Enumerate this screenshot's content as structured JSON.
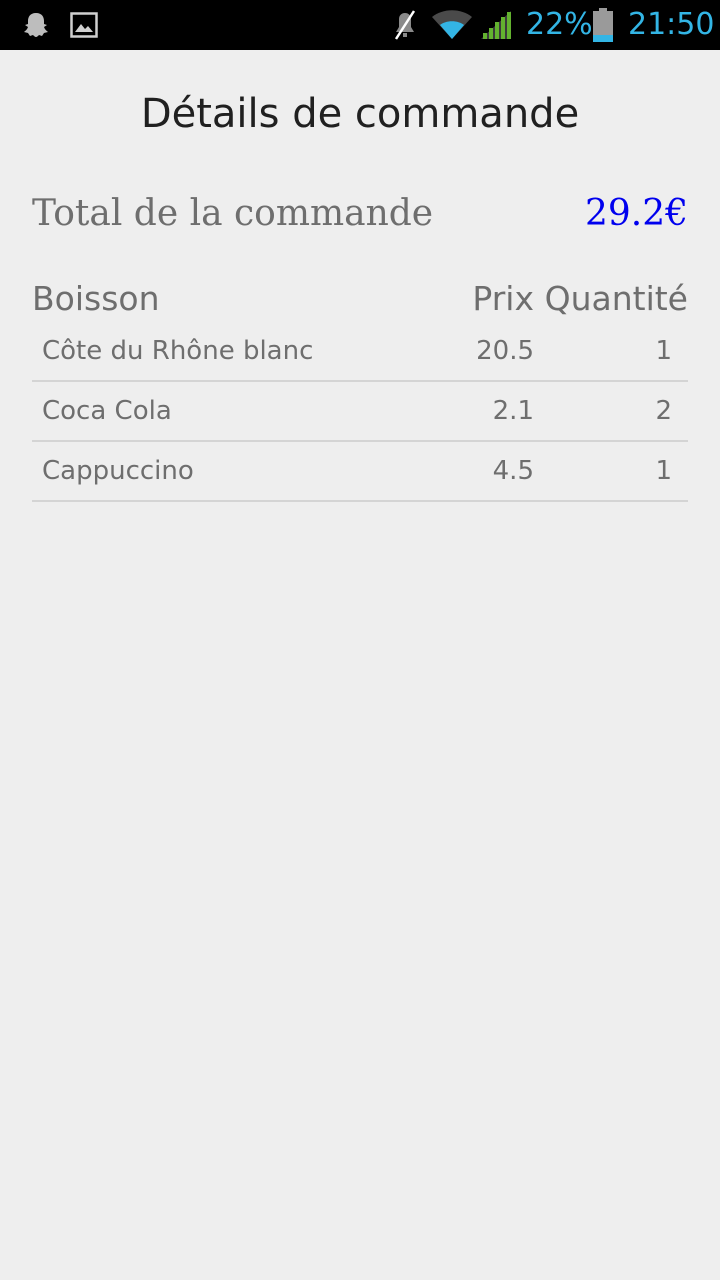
{
  "status_bar": {
    "icons_left": [
      "snapchat-ghost-icon",
      "image-icon"
    ],
    "icons_right": [
      "mute-icon",
      "wifi-icon",
      "signal-icon",
      "battery-icon"
    ],
    "battery_percent": "22%",
    "battery_level": 0.22,
    "time": "21:50",
    "accent_color": "#33b5e5"
  },
  "page": {
    "title": "Détails de commande"
  },
  "total": {
    "label": "Total de la commande",
    "value": "29.2€",
    "value_color": "#0000ee"
  },
  "table": {
    "headers": {
      "drink": "Boisson",
      "price": "Prix",
      "quantity": "Quantité"
    },
    "rows": [
      {
        "name": "Côte du Rhône blanc",
        "price": "20.5",
        "quantity": "1"
      },
      {
        "name": "Coca Cola",
        "price": "2.1",
        "quantity": "2"
      },
      {
        "name": "Cappuccino",
        "price": "4.5",
        "quantity": "1"
      }
    ]
  }
}
